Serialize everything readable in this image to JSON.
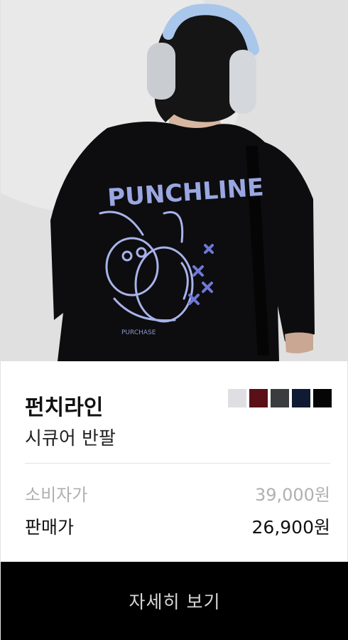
{
  "product": {
    "brand": "펀치라인",
    "name": "시큐어 반팔",
    "colors": [
      "#dfdfe3",
      "#5a1016",
      "#3b3c3e",
      "#101a33",
      "#050505"
    ],
    "list_price_label": "소비자가",
    "list_price": "39,000원",
    "sale_price_label": "판매가",
    "sale_price": "26,900원"
  },
  "image": {
    "shirt_print_text": "PUNCHLINE",
    "shirt_small_text": "PURCHASE"
  },
  "cta": {
    "label": "자세히 보기"
  }
}
